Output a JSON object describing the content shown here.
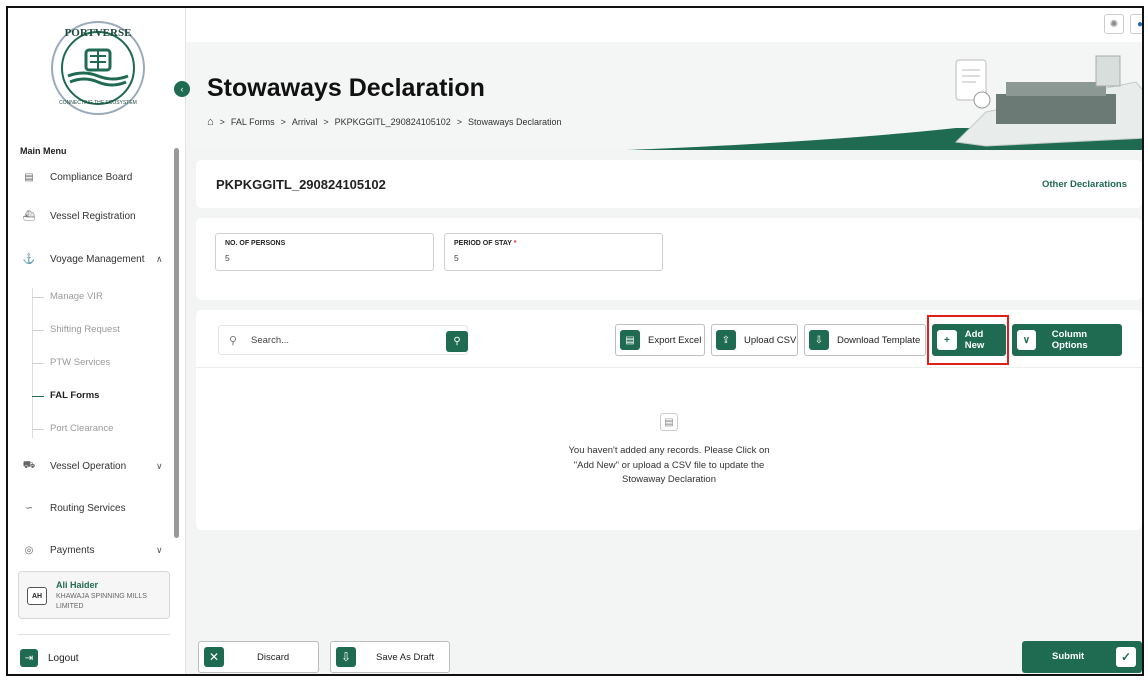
{
  "brand": {
    "logo_top": "PORTVERSE",
    "logo_bottom": "CONNECTING THE ECOSYSTEM"
  },
  "sidebar": {
    "menu_title": "Main Menu",
    "items": [
      {
        "label": "Compliance Board",
        "icon": "board-icon"
      },
      {
        "label": "Vessel Registration",
        "icon": "ship-icon"
      },
      {
        "label": "Voyage Management",
        "icon": "anchor-icon",
        "expanded": true
      },
      {
        "label": "Vessel Operation",
        "icon": "crane-icon"
      },
      {
        "label": "Routing Services",
        "icon": "route-icon"
      },
      {
        "label": "Payments",
        "icon": "payment-icon"
      }
    ],
    "sub_items": [
      "Manage VIR",
      "Shifting Request",
      "PTW Services",
      "FAL Forms",
      "Port Clearance"
    ],
    "active_sub_item": "FAL Forms",
    "user": {
      "initials": "AH",
      "name": "Ali Haider",
      "company": "KHAWAJA SPINNING MILLS LIMITED"
    },
    "logout_label": "Logout"
  },
  "header": {
    "title": "Stowaways Declaration",
    "breadcrumbs": [
      "FAL Forms",
      "Arrival",
      "PKPKGGITL_290824105102",
      "Stowaways Declaration"
    ]
  },
  "declaration": {
    "id": "PKPKGGITL_290824105102",
    "other_label": "Other Declarations"
  },
  "fields": [
    {
      "label": "NO. OF PERSONS",
      "value": "5",
      "required": false
    },
    {
      "label": "PERIOD OF STAY",
      "value": "5",
      "required": true
    }
  ],
  "toolbar": {
    "search_placeholder": "Search...",
    "export_excel": "Export Excel",
    "upload_csv": "Upload CSV",
    "download_template": "Download Template",
    "add_new": "Add New",
    "column_options": "Column Options"
  },
  "empty_state": {
    "message": "You haven't added any records. Please Click on \"Add New\" or upload a CSV file to update the Stowaway Declaration"
  },
  "footer": {
    "discard": "Discard",
    "save_draft": "Save As Draft",
    "submit": "Submit"
  },
  "colors": {
    "primary": "#1f6b52",
    "highlight": "#e0201a"
  }
}
